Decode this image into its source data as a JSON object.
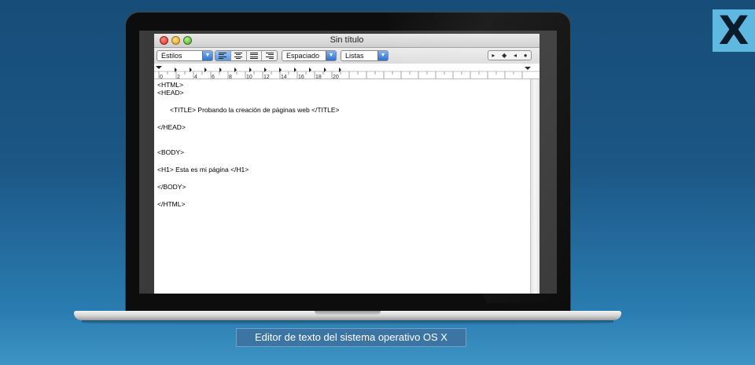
{
  "branding": {
    "logo_text": "X",
    "logo_bg": "#5fb8e0"
  },
  "window": {
    "title": "Sin título"
  },
  "toolbar": {
    "styles_label": "Estilos",
    "spacing_label": "Espaciado",
    "lists_label": "Listas",
    "align_buttons": [
      "align-left",
      "align-center",
      "align-justify",
      "align-right"
    ],
    "active_align": "align-left",
    "nav_glyphs": [
      "▸",
      "◆",
      "◂",
      "●"
    ]
  },
  "ruler": {
    "labels": [
      "0",
      "2",
      "4",
      "6",
      "8",
      "10",
      "12",
      "14",
      "16",
      "18",
      "20"
    ]
  },
  "document": {
    "lines": [
      "<HTML>",
      "<HEAD>",
      "<TITLE> Probando la creación de páginas web </TITLE>",
      "</HEAD>",
      "<BODY>",
      "<H1> Esta es mi página </H1>",
      "</BODY>",
      "</HTML>"
    ]
  },
  "caption": "Editor de texto del sistema operativo OS X"
}
